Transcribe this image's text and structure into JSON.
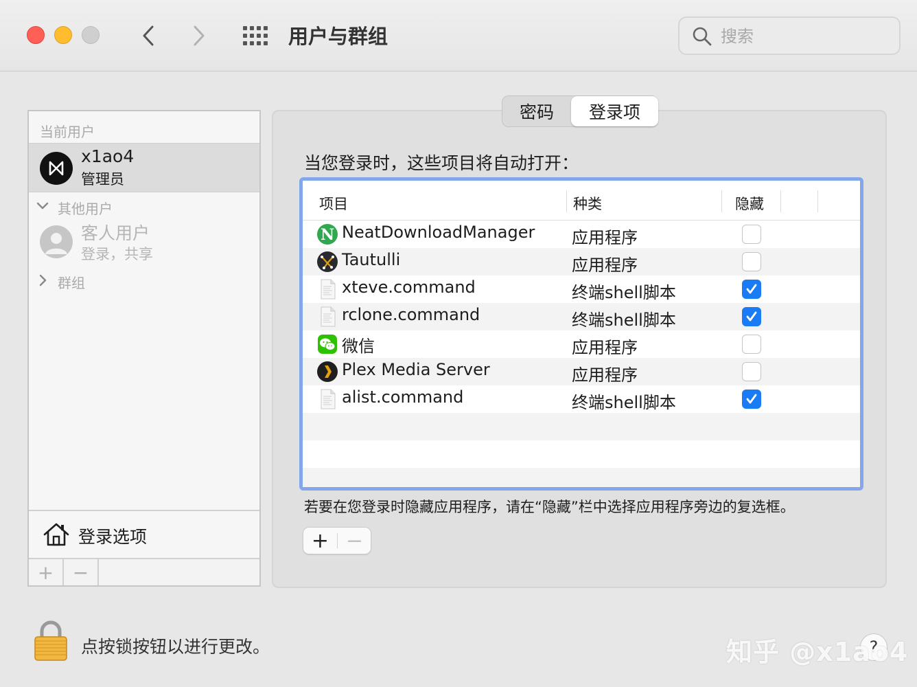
{
  "window": {
    "title": "用户与群组",
    "search_placeholder": "搜索"
  },
  "sidebar": {
    "current_section": "当前用户",
    "current_user": {
      "name": "x1ao4",
      "role": "管理员"
    },
    "other_section": "其他用户",
    "guest_user": {
      "name": "客人用户",
      "subtitle": "登录，共享"
    },
    "groups_section": "群组",
    "login_options": "登录选项",
    "add_label": "+",
    "remove_label": "−"
  },
  "tabs": [
    {
      "label": "密码",
      "selected": false
    },
    {
      "label": "登录项",
      "selected": true
    }
  ],
  "main": {
    "intro": "当您登录时，这些项目将自动打开：",
    "columns": {
      "item": "项目",
      "kind": "种类",
      "hide": "隐藏"
    },
    "rows": [
      {
        "name": "NeatDownloadManager",
        "kind": "应用程序",
        "hidden": false,
        "icon": "neat-download-manager-icon"
      },
      {
        "name": "Tautulli",
        "kind": "应用程序",
        "hidden": false,
        "icon": "tautulli-icon"
      },
      {
        "name": "xteve.command",
        "kind": "终端shell脚本",
        "hidden": true,
        "icon": "script-document-icon"
      },
      {
        "name": "rclone.command",
        "kind": "终端shell脚本",
        "hidden": true,
        "icon": "script-document-icon"
      },
      {
        "name": "微信",
        "kind": "应用程序",
        "hidden": false,
        "icon": "wechat-icon"
      },
      {
        "name": "Plex Media Server",
        "kind": "应用程序",
        "hidden": false,
        "icon": "plex-icon"
      },
      {
        "name": "alist.command",
        "kind": "终端shell脚本",
        "hidden": true,
        "icon": "script-document-icon"
      }
    ],
    "hint": "若要在您登录时隐藏应用程序，请在“隐藏”栏中选择应用程序旁边的复选框。",
    "add_label": "+",
    "remove_label": "−"
  },
  "footer": {
    "lock_text": "点按锁按钮以进行更改。",
    "help_label": "?",
    "watermark": "知乎 @x1ao4"
  },
  "colors": {
    "accent": "#1a7cf5",
    "focus_ring": "#84a6ea",
    "close": "#fe5f57",
    "minimize": "#febc2e"
  }
}
